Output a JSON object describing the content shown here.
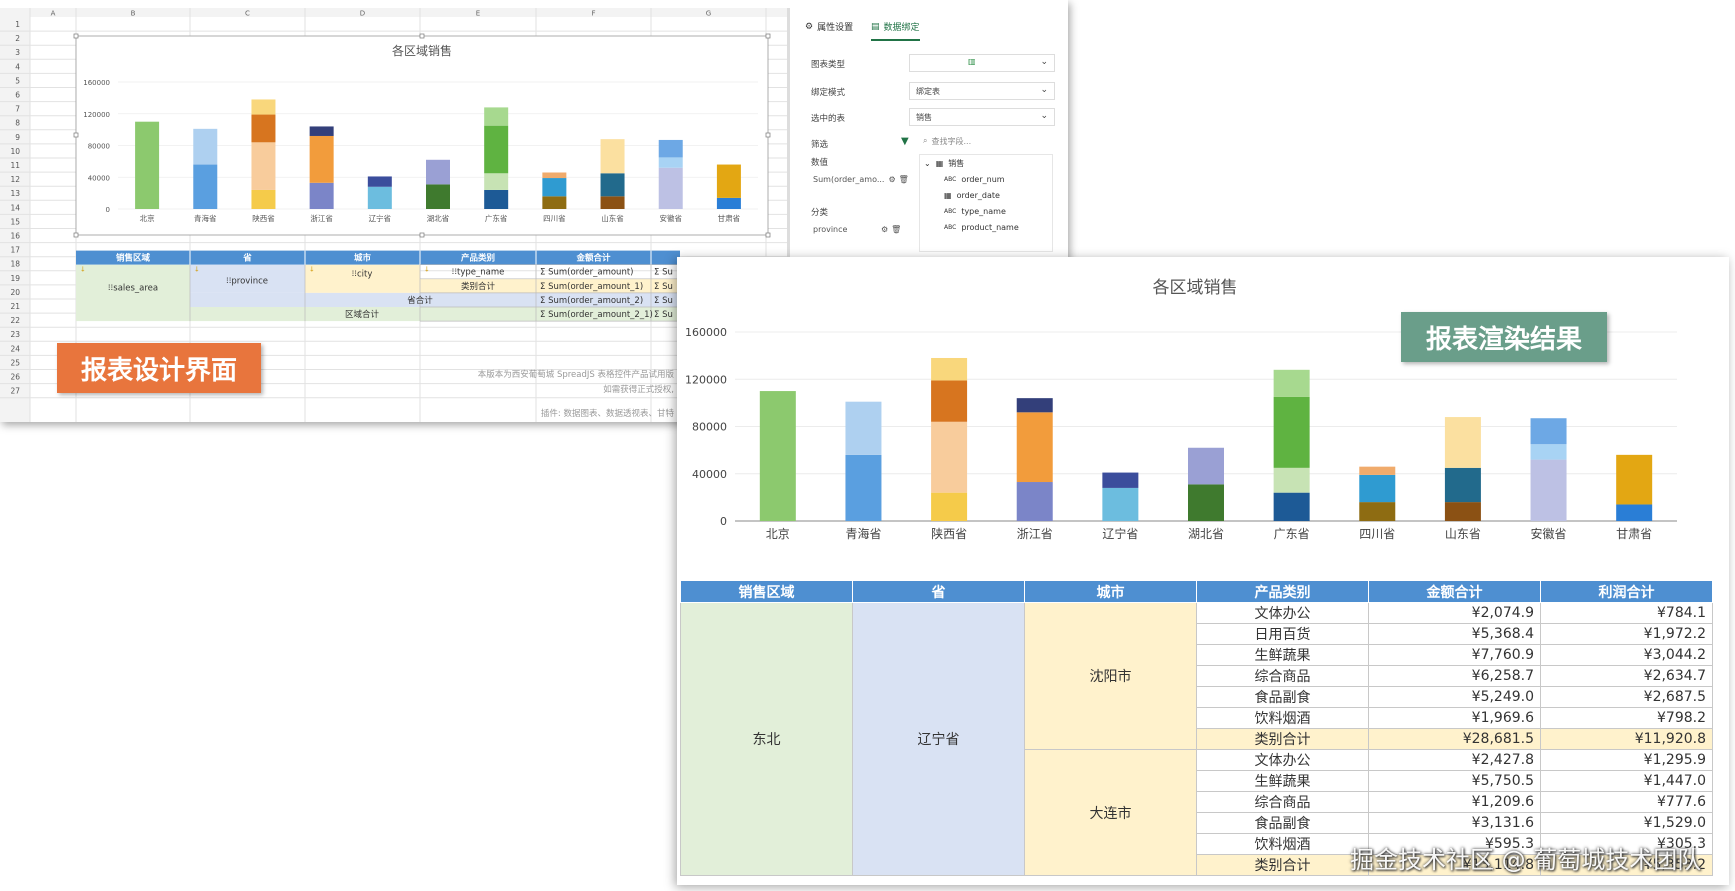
{
  "designer": {
    "col_headers": [
      "A",
      "B",
      "C",
      "D",
      "E",
      "F",
      "G"
    ],
    "row_numbers": [
      "1",
      "2",
      "3",
      "4",
      "5",
      "6",
      "7",
      "8",
      "9",
      "10",
      "11",
      "12",
      "13",
      "14",
      "15",
      "16",
      "17",
      "18",
      "19",
      "20",
      "21",
      "22",
      "23",
      "24",
      "25",
      "26",
      "27"
    ],
    "template_headers": [
      "销售区域",
      "省",
      "城市",
      "产品类别",
      "金额合计"
    ],
    "cell_sales_area": "sales_area",
    "cell_province": "province",
    "cell_city": "city",
    "cell_type_name": "type_name",
    "cell_sum1": "Sum(order_amount)",
    "cell_sum2": "Sum(order_amount_1)",
    "cell_sum3": "Sum(order_amount_2)",
    "cell_sum4": "Sum(order_amount_2_1)",
    "cell_sum_cut": "Su",
    "label_category_total": "类别合计",
    "label_province_total": "省合计",
    "label_area_total": "区域合计",
    "notice_line1": "本版本为西安葡萄城 SpreadJS 表格控件产品试用版",
    "notice_line2": "如需获得正式授权,",
    "notice_line3": "插件: 数据图表、数据透视表、甘特",
    "overlay_label": "报表设计界面"
  },
  "side_panel": {
    "tab_props": "属性设置",
    "tab_binding": "数据绑定",
    "chart_type_label": "图表类型",
    "bind_mode_label": "绑定模式",
    "bind_mode_value": "绑定表",
    "selected_table_label": "选中的表",
    "selected_table_value": "销售",
    "filter_label": "筛选",
    "value_label": "数值",
    "value_field": "Sum(order_amo...",
    "category_label": "分类",
    "category_field": "province",
    "search_placeholder": "查找字段...",
    "tree_table": "销售",
    "tree_fields": [
      "order_num",
      "order_date",
      "type_name",
      "product_name"
    ]
  },
  "chart_data": {
    "type": "bar",
    "stacked": true,
    "title": "各区域销售",
    "categories": [
      "北京",
      "青海省",
      "陕西省",
      "浙江省",
      "辽宁省",
      "湖北省",
      "广东省",
      "四川省",
      "山东省",
      "安徽省",
      "甘肃省"
    ],
    "ylim": [
      0,
      160000
    ],
    "yticks": [
      0,
      40000,
      80000,
      120000,
      160000
    ],
    "grid": true,
    "stacks": [
      [
        {
          "value": 110000,
          "color": "#8cc96e"
        }
      ],
      [
        {
          "value": 56000,
          "color": "#5a9fe0"
        },
        {
          "value": 45000,
          "color": "#aed0f0"
        }
      ],
      [
        {
          "value": 24000,
          "color": "#f5cb4a"
        },
        {
          "value": 60000,
          "color": "#f8cc9c"
        },
        {
          "value": 35000,
          "color": "#d7751f"
        },
        {
          "value": 19000,
          "color": "#f9d77c"
        }
      ],
      [
        {
          "value": 33000,
          "color": "#7b85c8"
        },
        {
          "value": 59000,
          "color": "#f29c3c"
        },
        {
          "value": 12000,
          "color": "#333f7a"
        }
      ],
      [
        {
          "value": 28000,
          "color": "#6cbddf"
        },
        {
          "value": 13000,
          "color": "#3b4d9c"
        }
      ],
      [
        {
          "value": 31000,
          "color": "#3f7a2e"
        },
        {
          "value": 31000,
          "color": "#9aa0d4"
        }
      ],
      [
        {
          "value": 24000,
          "color": "#1d5a96"
        },
        {
          "value": 21000,
          "color": "#c7e3b4"
        },
        {
          "value": 60000,
          "color": "#5fb341"
        },
        {
          "value": 23000,
          "color": "#a7d98f"
        }
      ],
      [
        {
          "value": 16000,
          "color": "#8e6c12"
        },
        {
          "value": 23000,
          "color": "#2f9bd1"
        },
        {
          "value": 7000,
          "color": "#f0ab6c"
        }
      ],
      [
        {
          "value": 16000,
          "color": "#8b5114"
        },
        {
          "value": 29000,
          "color": "#226a8c"
        },
        {
          "value": 43000,
          "color": "#fbe0a0"
        }
      ],
      [
        {
          "value": 52000,
          "color": "#bdc1e4"
        },
        {
          "value": 13000,
          "color": "#a8d3f4"
        },
        {
          "value": 22000,
          "color": "#6da8e5"
        }
      ],
      [
        {
          "value": 14000,
          "color": "#2a7ed6"
        },
        {
          "value": 42000,
          "color": "#e3a713"
        }
      ]
    ]
  },
  "render": {
    "overlay_label": "报表渲染结果",
    "headers": [
      "销售区域",
      "省",
      "城市",
      "产品类别",
      "金额合计",
      "利润合计"
    ],
    "area": "东北",
    "province": "辽宁省",
    "cities": [
      {
        "name": "沈阳市",
        "rows": [
          {
            "cat": "文体办公",
            "amt": "¥2,074.9",
            "profit": "¥784.1"
          },
          {
            "cat": "日用百货",
            "amt": "¥5,368.4",
            "profit": "¥1,972.2"
          },
          {
            "cat": "生鲜蔬果",
            "amt": "¥7,760.9",
            "profit": "¥3,044.2"
          },
          {
            "cat": "综合商品",
            "amt": "¥6,258.7",
            "profit": "¥2,634.7"
          },
          {
            "cat": "食品副食",
            "amt": "¥5,249.0",
            "profit": "¥2,687.5"
          },
          {
            "cat": "饮料烟酒",
            "amt": "¥1,969.6",
            "profit": "¥798.2"
          }
        ],
        "subtotal": {
          "cat": "类别合计",
          "amt": "¥28,681.5",
          "profit": "¥11,920.8"
        }
      },
      {
        "name": "大连市",
        "rows": [
          {
            "cat": "文体办公",
            "amt": "¥2,427.8",
            "profit": "¥1,295.9"
          },
          {
            "cat": "生鲜蔬果",
            "amt": "¥5,750.5",
            "profit": "¥1,447.0"
          },
          {
            "cat": "综合商品",
            "amt": "¥1,209.6",
            "profit": "¥777.6"
          },
          {
            "cat": "食品副食",
            "amt": "¥3,131.6",
            "profit": "¥1,529.0"
          },
          {
            "cat": "饮料烟酒",
            "amt": "¥595.3",
            "profit": "¥305.3"
          }
        ],
        "subtotal": {
          "cat": "类别合计",
          "amt": "¥13,114.8",
          "profit": "¥5,353.2"
        }
      }
    ]
  },
  "watermark": "掘金技术社区 @ 葡萄城技术团队"
}
